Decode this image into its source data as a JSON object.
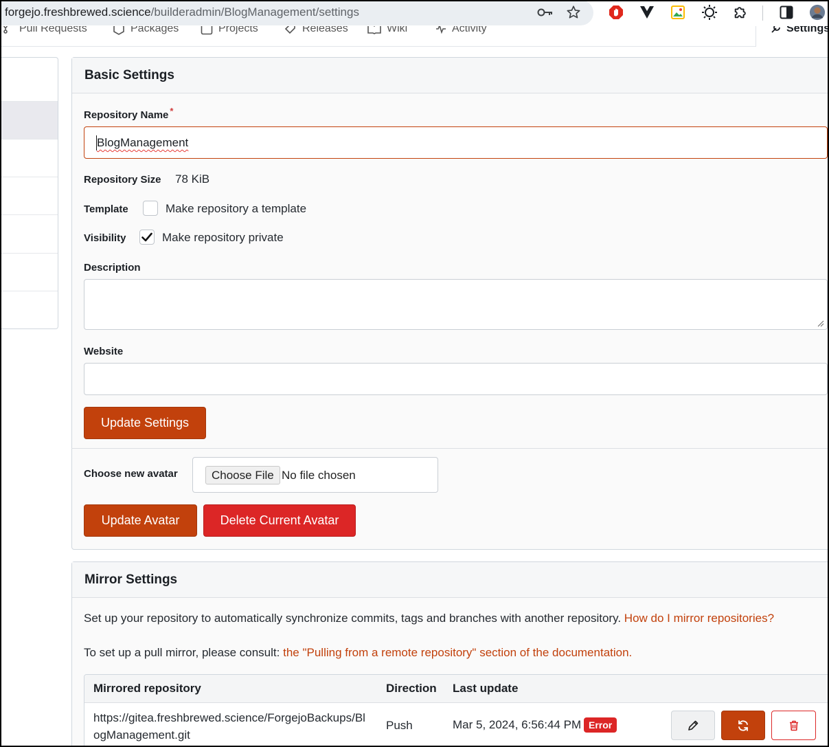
{
  "browser": {
    "url_host": "forgejo.freshbrewed.science",
    "url_path": "/builderadmin/BlogManagement/settings"
  },
  "repo_tabs": [
    {
      "label": "Pull Requests",
      "icon": "pull-request-icon"
    },
    {
      "label": "Packages",
      "icon": "package-icon"
    },
    {
      "label": "Projects",
      "icon": "project-icon"
    },
    {
      "label": "Releases",
      "icon": "tag-icon"
    },
    {
      "label": "Wiki",
      "icon": "book-icon"
    },
    {
      "label": "Activity",
      "icon": "pulse-icon"
    }
  ],
  "settings_tab": {
    "label": "Settings",
    "icon": "tool-icon"
  },
  "basic": {
    "header": "Basic Settings",
    "repo_name_label": "Repository Name",
    "required_mark": "*",
    "repo_name_value": "BlogManagement",
    "repo_size_label": "Repository Size",
    "repo_size_value": "78 KiB",
    "template_label": "Template",
    "template_checkbox_label": "Make repository a template",
    "template_checked": false,
    "visibility_label": "Visibility",
    "visibility_checkbox_label": "Make repository private",
    "visibility_checked": true,
    "description_label": "Description",
    "description_value": "",
    "website_label": "Website",
    "website_value": "",
    "update_settings_btn": "Update Settings",
    "avatar_label": "Choose new avatar",
    "choose_file_btn": "Choose File",
    "no_file_text": "No file chosen",
    "update_avatar_btn": "Update Avatar",
    "delete_avatar_btn": "Delete Current Avatar"
  },
  "mirror": {
    "header": "Mirror Settings",
    "intro_text": "Set up your repository to automatically synchronize commits, tags and branches with another repository.",
    "intro_link": "How do I mirror repositories?",
    "pull_text": "To set up a pull mirror, please consult:",
    "pull_link": "the \"Pulling from a remote repository\" section of the documentation.",
    "columns": {
      "repo": "Mirrored repository",
      "direction": "Direction",
      "last_update": "Last update"
    },
    "rows": [
      {
        "repo_line1": "https://gitea.freshbrewed.science/ForgejoBackups/Bl",
        "repo_line2": "ogManagement.git",
        "direction": "Push",
        "last_update": "Mar 5, 2024, 6:56:44 PM",
        "status": "Error"
      }
    ]
  },
  "colors": {
    "accent": "#c2410c",
    "danger": "#dc2626"
  }
}
